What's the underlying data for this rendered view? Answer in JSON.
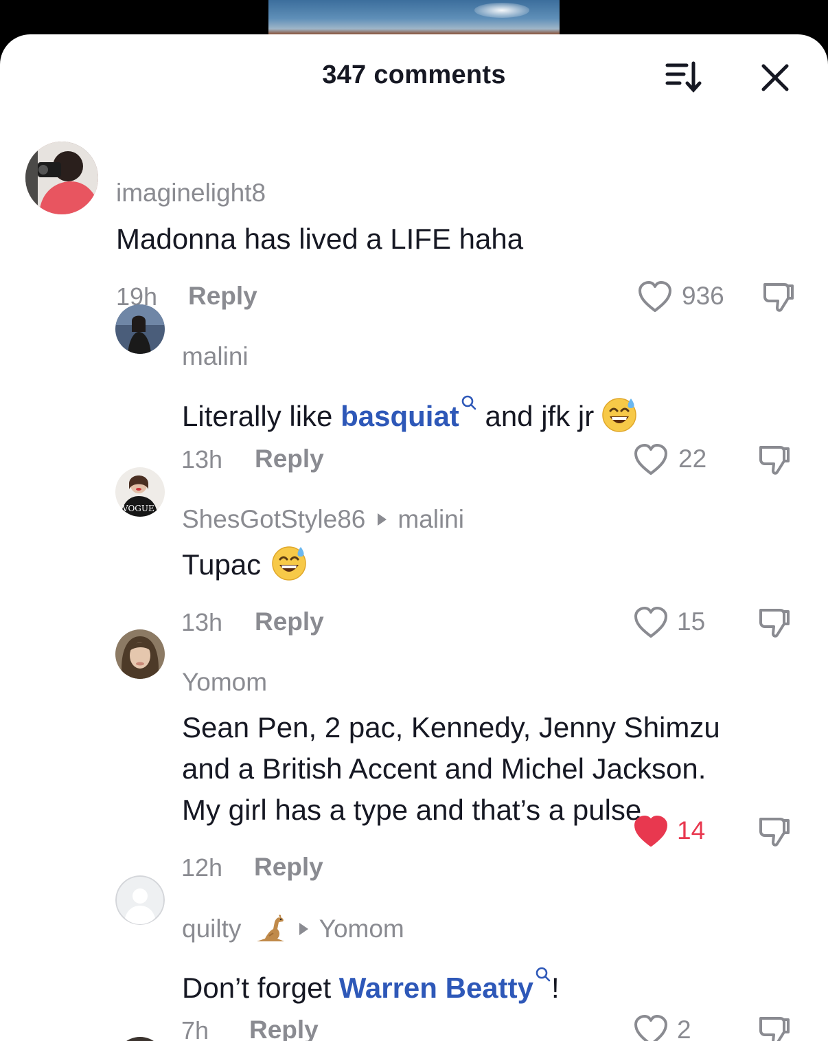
{
  "header": {
    "title": "347 comments",
    "sort_icon": "sort-icon",
    "close_icon": "close-icon"
  },
  "colors": {
    "text": "#161823",
    "muted": "#8a8b91",
    "link": "#2e58b8",
    "liked": "#e8384f"
  },
  "comments": [
    {
      "username": "imaginelight8",
      "text": "Madonna has lived a LIFE haha",
      "time": "19h",
      "reply_label": "Reply",
      "likes": "936",
      "liked": false
    },
    {
      "username": "malini",
      "text_before": "Literally like ",
      "link": "basquiat",
      "text_after": " and jfk jr",
      "emoji": "sweat-smile-emoji",
      "time": "13h",
      "reply_label": "Reply",
      "likes": "22",
      "liked": false
    },
    {
      "username": "ShesGotStyle86",
      "reply_to": "malini",
      "text": "Tupac",
      "emoji": "sweat-smile-emoji",
      "time": "13h",
      "reply_label": "Reply",
      "likes": "15",
      "liked": false
    },
    {
      "username": "Yomom",
      "text_lines": [
        "Sean Pen, 2 pac, Kennedy, Jenny Shimzu",
        "and a British Accent and Michel Jackson.",
        "My girl has a type and that’s a pulse"
      ],
      "time": "12h",
      "reply_label": "Reply",
      "likes": "14",
      "liked": true
    },
    {
      "username": "quilty",
      "username_emoji": "kangaroo-emoji",
      "reply_to": "Yomom",
      "text_before": "Don’t forget ",
      "link": "Warren Beatty",
      "text_after": "!",
      "time": "7h",
      "reply_label": "Reply",
      "likes": "2",
      "liked": false
    }
  ]
}
